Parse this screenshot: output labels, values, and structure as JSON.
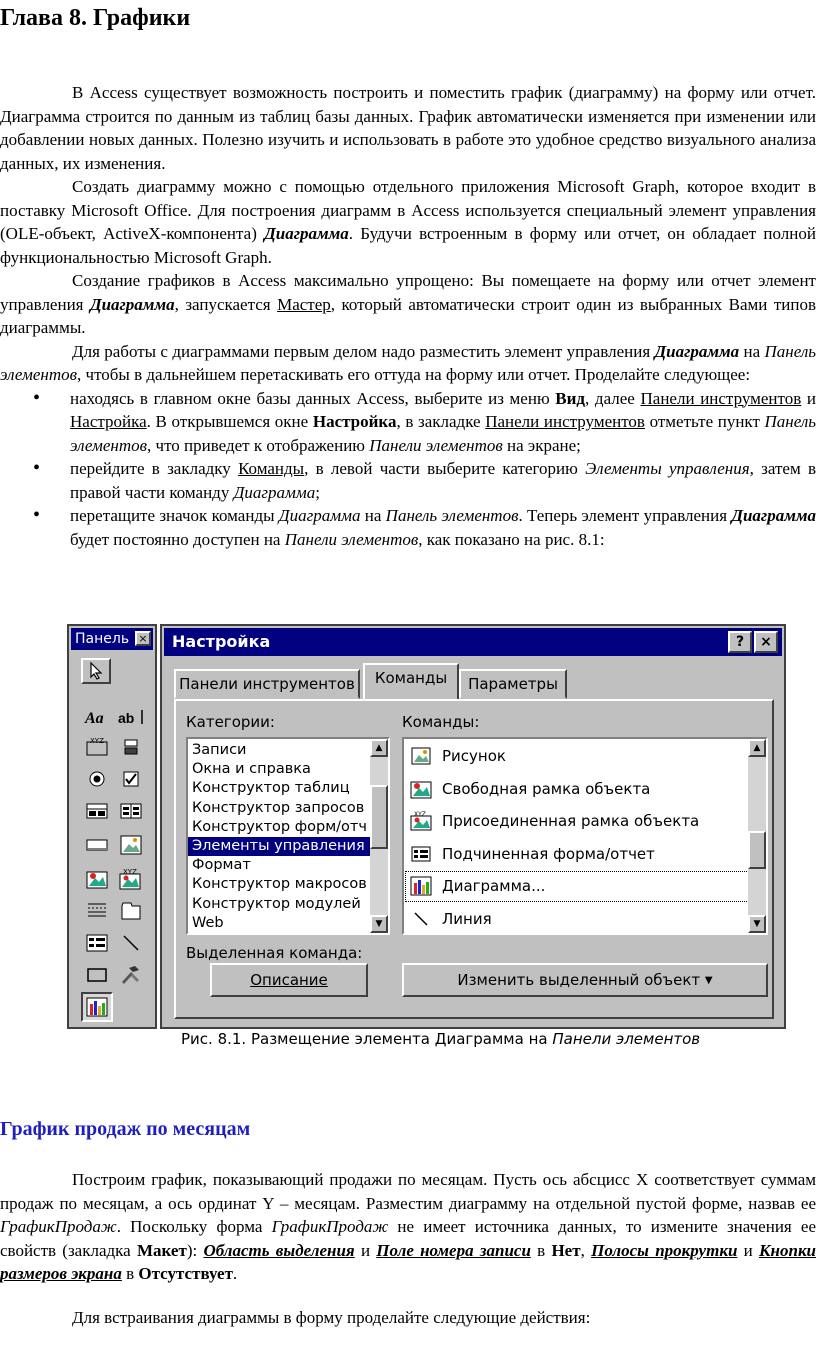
{
  "chapter_title": "Глава 8. Графики",
  "intro": {
    "p1": "В Access существует возможность построить и поместить график (диаграмму) на форму или отчет. Диаграмма строится по данным из таблиц базы данных. График автоматически изменяется при изменении или добавлении новых данных. Полезно изучить и использовать в работе это удобное средство визуального анализа данных, их изменения.",
    "p2_a": "Создать диаграмму можно с помощью отдельного приложения Microsoft Graph, которое входит в поставку Microsoft Office. Для построения диаграмм в Access используется специальный элемент управления (OLE-объект, ActiveX-компонента) ",
    "p2_b": "Диаграмма",
    "p2_c": ". Будучи встроенным в форму или отчет, он обладает полной функциональностью Microsoft Graph.",
    "p3_a": "Создание графиков в Access максимально упрощено: Вы помещаете на форму или отчет элемент управления ",
    "p3_b": "Диаграмма",
    "p3_c": ", запускается ",
    "p3_d": "Мастер",
    "p3_e": ", который автоматически строит один из выбранных Вами типов диаграммы.",
    "p4_a": "Для работы с диаграммами первым делом надо разместить элемент управления ",
    "p4_b": "Диаграмма",
    "p4_c": " на ",
    "p4_d": "Панель элементов",
    "p4_e": ", чтобы в дальнейшем перетаскивать его оттуда на форму или отчет. Проделайте следующее:"
  },
  "bullets": {
    "b1_a": "находясь в главном окне базы данных Access, выберите из меню ",
    "b1_b": "Вид",
    "b1_c": ", далее ",
    "b1_d": "Панели инструментов",
    "b1_e": " и ",
    "b1_f": "Настройка",
    "b1_g": ". В открывшемся окне ",
    "b1_h": "Настройка",
    "b1_i": ", в закладке ",
    "b1_j": "Панели инструментов",
    "b1_k": " отметьте пункт ",
    "b1_l": "Панель элементов",
    "b1_m": ", что приведет к отображению ",
    "b1_n": "Панели элементов",
    "b1_o": " на экране;",
    "b2_a": "перейдите в закладку ",
    "b2_b": "Команды",
    "b2_c": ", в левой части выберите категорию ",
    "b2_d": "Элементы управления",
    "b2_e": ", затем в правой части команду ",
    "b2_f": "Диаграмма",
    "b2_g": ";",
    "b3_a": "перетащите значок команды ",
    "b3_b": "Диаграмма",
    "b3_c": " на ",
    "b3_d": "Панель элементов",
    "b3_e": ". Теперь элемент управления ",
    "b3_f": "Диаграмма",
    "b3_g": " будет постоянно доступен на ",
    "b3_h": "Панели элементов",
    "b3_i": ", как показано на рис. 8.1:"
  },
  "figure": {
    "toolbox_title": "Панель",
    "close_glyph": "×",
    "dialog_title": "Настройка",
    "help_glyph": "?",
    "tabs": [
      "Панели инструментов",
      "Команды",
      "Параметры"
    ],
    "categories_label": "Категории:",
    "commands_label": "Команды:",
    "categories": [
      "Записи",
      "Окна и справка",
      "Конструктор таблиц",
      "Конструктор запросов",
      "Конструктор форм/отч",
      "Элементы управления",
      "Формат",
      "Конструктор макросов",
      "Конструктор модулей",
      "Web"
    ],
    "selected_category_index": 5,
    "commands": [
      "Рисунок",
      "Свободная рамка объекта",
      "Присоединенная рамка объекта",
      "Подчиненная форма/отчет",
      "Диаграмма...",
      "Линия"
    ],
    "selected_command_label": "Выделенная команда:",
    "describe_button": "Описание",
    "modify_button": "Изменить выделенный объект",
    "caption_a": "Рис. 8.1.  Размещение элемента Диаграмма на ",
    "caption_b": "Панели элементов"
  },
  "section2": {
    "title": "График продаж по месяцам",
    "p1_a": "Построим график, показывающий продажи по месяцам. Пусть ось абсцисс X соответствует суммам продаж по месяцам, а ось ординат Y – месяцам. Разместим диаграмму на отдельной пустой форме, назвав ее ",
    "p1_b": "ГрафикПродаж",
    "p1_c": ". Поскольку форма ",
    "p1_d": "ГрафикПродаж",
    "p1_e": " не имеет источника данных, то измените значения ее свойств (закладка ",
    "p1_f": "Макет",
    "p1_g": "): ",
    "p1_h": "Область выделения",
    "p1_i": " и ",
    "p1_j": "Поле номера записи",
    "p1_k": " в ",
    "p1_l": "Нет",
    "p1_m": ", ",
    "p1_n": "Полосы прокрутки",
    "p1_o": " и ",
    "p1_p": "Кнопки размеров экрана",
    "p1_q": " в ",
    "p1_r": "Отсутствует",
    "p1_s": ".",
    "p2": "Для встраивания диаграммы в форму проделайте следующие действия:"
  }
}
